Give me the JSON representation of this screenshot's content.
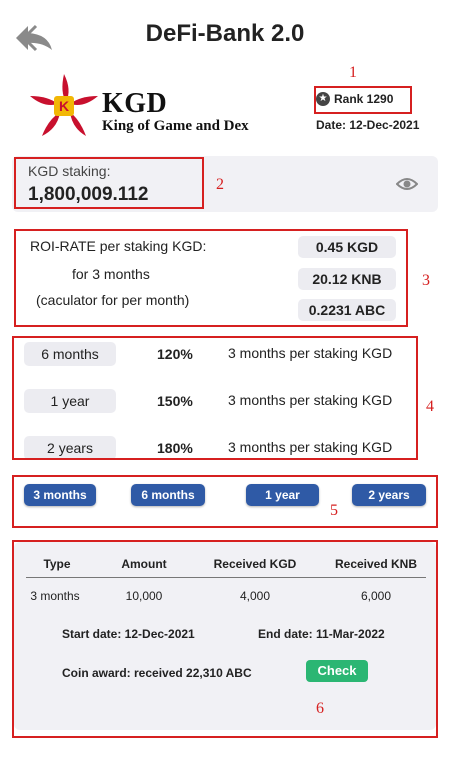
{
  "header": {
    "title": "DeFi-Bank 2.0"
  },
  "brand": {
    "name": "KGD",
    "tagline": "King of Game and Dex",
    "logo_letter": "K"
  },
  "rank": {
    "label": "Rank 1290"
  },
  "date": {
    "label": "Date: 12-Dec-2021"
  },
  "staking": {
    "label": "KGD staking:",
    "value": "1,800,009.112"
  },
  "roi": {
    "line1": "ROI-RATE per staking KGD:",
    "line2": "for 3 months",
    "line3": "(caculator for per month)",
    "values": [
      "0.45 KGD",
      "20.12 KNB",
      "0.2231 ABC"
    ]
  },
  "durations": [
    {
      "period": "6 months",
      "rate": "120%",
      "desc": "3 months per staking KGD"
    },
    {
      "period": "1 year",
      "rate": "150%",
      "desc": "3 months per staking KGD"
    },
    {
      "period": "2 years",
      "rate": "180%",
      "desc": "3 months per staking KGD"
    }
  ],
  "buttons": [
    "3 months",
    "6 months",
    "1 year",
    "2 years"
  ],
  "result": {
    "headers": [
      "Type",
      "Amount",
      "Received KGD",
      "Received KNB"
    ],
    "row": [
      "3 months",
      "10,000",
      "4,000",
      "6,000"
    ],
    "start_date": "Start date: 12-Dec-2021",
    "end_date": "End date: 11-Mar-2022",
    "award": "Coin award: received 22,310 ABC",
    "check_label": "Check"
  },
  "annotations": [
    "1",
    "2",
    "3",
    "4",
    "5",
    "6"
  ],
  "colors": {
    "accent_blue": "#2f5aa6",
    "check_green": "#2bb673",
    "annotation_red": "#d62020",
    "logo_red": "#c8102e"
  }
}
